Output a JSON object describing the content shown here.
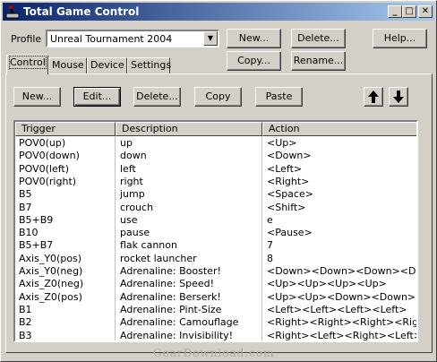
{
  "window": {
    "title": "Total Game Control",
    "min_glyph": "_",
    "max_glyph": "□",
    "close_glyph": "✕"
  },
  "profile": {
    "label": "Profile",
    "selected": "Unreal Tournament 2004",
    "buttons": {
      "new": "New...",
      "delete": "Delete...",
      "help": "Help...",
      "copy": "Copy...",
      "rename": "Rename..."
    }
  },
  "tabs": [
    "Control",
    "Mouse",
    "Device",
    "Settings"
  ],
  "toolbar": {
    "new": "New...",
    "edit": "Edit...",
    "delete": "Delete...",
    "copy": "Copy",
    "paste": "Paste"
  },
  "table": {
    "headers": [
      "Trigger",
      "Description",
      "Action"
    ],
    "rows": [
      [
        "POV0(up)",
        "up",
        "<Up>"
      ],
      [
        "POV0(down)",
        "down",
        "<Down>"
      ],
      [
        "POV0(left)",
        "left",
        "<Left>"
      ],
      [
        "POV0(right)",
        "right",
        "<Right>"
      ],
      [
        "B5",
        "jump",
        "<Space>"
      ],
      [
        "B7",
        "crouch",
        "<Shift>"
      ],
      [
        "B5+B9",
        "use",
        "e"
      ],
      [
        "B10",
        "pause",
        "<Pause>"
      ],
      [
        "B5+B7",
        "flak cannon",
        "7"
      ],
      [
        "Axis_Y0(pos)",
        "rocket launcher",
        "8"
      ],
      [
        "Axis_Y0(neg)",
        "Adrenaline: Booster!",
        "<Down><Down><Down><Down>"
      ],
      [
        "Axis_Z0(neg)",
        "Adrenaline: Speed!",
        "<Up><Up><Up><Up>"
      ],
      [
        "Axis_Z0(pos)",
        "Adrenaline: Berserk!",
        "<Up><Up><Down><Down>"
      ],
      [
        "B1",
        "Adrenaline: Pint-Size",
        "<Left><Left><Left><Left>"
      ],
      [
        "B2",
        "Adrenaline: Camouflage",
        "<Right><Right><Right><Right>"
      ],
      [
        "B3",
        "Adrenaline: Invisibility!",
        "<Right><Left><Right><Left>"
      ]
    ]
  },
  "watermark": "GearDownload.com"
}
